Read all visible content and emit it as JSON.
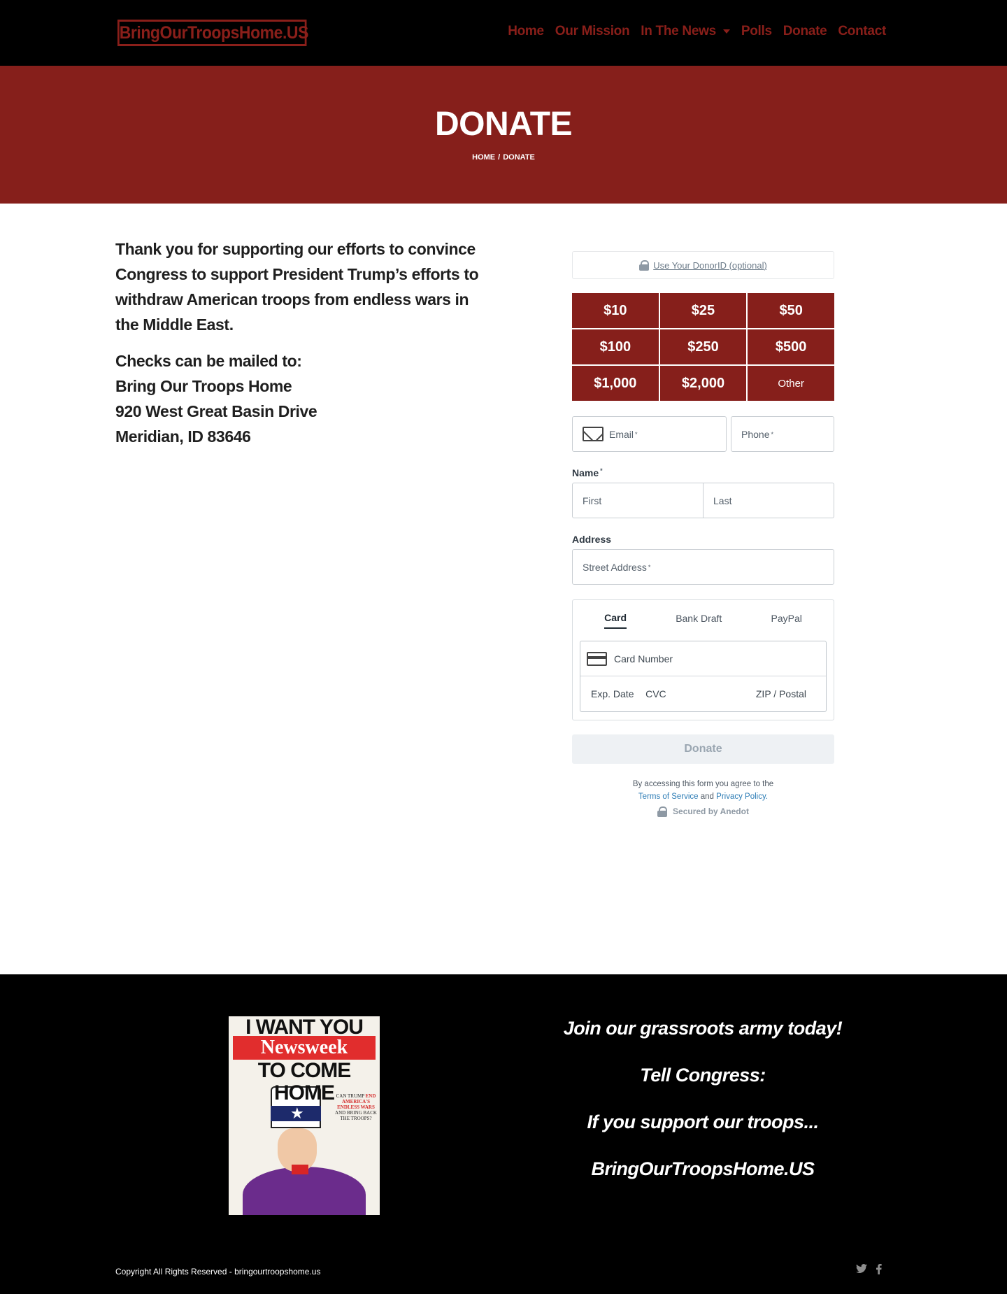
{
  "header": {
    "logo": "BringOurTroopsHome.US",
    "nav": [
      "Home",
      "Our Mission",
      "In The News",
      "Polls",
      "Donate",
      "Contact"
    ]
  },
  "hero": {
    "title": "DONATE",
    "breadcrumb_home": "HOME",
    "breadcrumb_sep": "/",
    "breadcrumb_current": "DONATE"
  },
  "intro": {
    "thanks": "Thank you for supporting our efforts to convince Congress to support President Trump’s efforts to withdraw American troops from endless wars in the Middle East.",
    "address_lines": [
      "Checks can be mailed to:",
      "Bring Our Troops Home",
      "920 West Great Basin Drive",
      "Meridian, ID 83646"
    ]
  },
  "form": {
    "donor_id": "Use Your DonorID (optional)",
    "amounts": [
      "$10",
      "$25",
      "$50",
      "$100",
      "$250",
      "$500",
      "$1,000",
      "$2,000",
      "Other"
    ],
    "email_placeholder": "Email",
    "phone_placeholder": "Phone",
    "required_mark": "*",
    "name_label": "Name",
    "first_placeholder": "First",
    "last_placeholder": "Last",
    "address_label": "Address",
    "street_placeholder": "Street Address",
    "payment_tabs": [
      "Card",
      "Bank Draft",
      "PayPal"
    ],
    "card_number": "Card Number",
    "exp_date": "Exp. Date",
    "cvc": "CVC",
    "zip": "ZIP / Postal",
    "donate_button": "Donate",
    "legal_prefix": "By accessing this form you agree to the",
    "terms": "Terms of Service",
    "and": "and",
    "privacy": "Privacy Policy.",
    "secured": "Secured by Anedot"
  },
  "footer": {
    "poster": {
      "line1": "I WANT YOU",
      "masthead": "Newsweek",
      "line2": "TO COME HOME"
    },
    "join_lines": [
      "Join our grassroots army today!",
      "Tell Congress:",
      "If you support our troops...",
      "BringOurTroopsHome.US"
    ],
    "copyright": "Copyright All Rights Reserved - bringourtroopshome.us",
    "social": [
      "twitter-icon",
      "facebook-icon"
    ]
  },
  "colors": {
    "accent": "#861f1b",
    "header_bg": "#000000",
    "link_blue": "#2c7cb5"
  }
}
